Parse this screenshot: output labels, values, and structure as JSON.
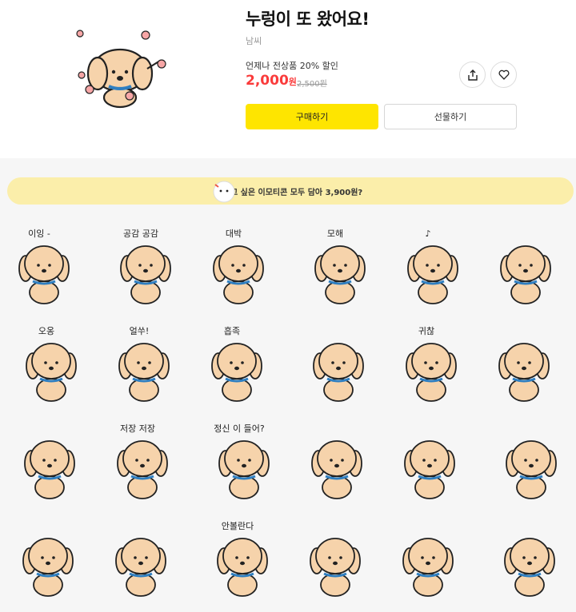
{
  "product": {
    "title": "누렁이 또 왔어요!",
    "author": "남씨",
    "promo_text": "언제나 전상품 20% 할인",
    "price": "2,000",
    "price_unit": "원",
    "original_price": "2,500원"
  },
  "actions": {
    "share_icon": "share-icon",
    "like_icon": "heart-icon",
    "buy_label": "구매하기",
    "gift_label": "선물하기"
  },
  "banner": {
    "text": "사고 싶은 이모티콘 모두 담아 3,900원?"
  },
  "colors": {
    "accent_yellow": "#fee500",
    "price_red": "#fa3b3b",
    "banner_bg": "#fbeeaa",
    "dog_fill": "#f6d3ab",
    "collar": "#2f7fc1"
  },
  "stickers": [
    {
      "caption": "이잉 -"
    },
    {
      "caption": "공감 공감"
    },
    {
      "caption": "대박"
    },
    {
      "caption": "모해"
    },
    {
      "caption": "♪"
    },
    {
      "caption": ""
    },
    {
      "caption": "오옹"
    },
    {
      "caption": "얼쑤!"
    },
    {
      "caption": "흡족"
    },
    {
      "caption": ""
    },
    {
      "caption": "귀찮"
    },
    {
      "caption": ""
    },
    {
      "caption": ""
    },
    {
      "caption": "저장 저장"
    },
    {
      "caption": "정신 이 들어?"
    },
    {
      "caption": ""
    },
    {
      "caption": ""
    },
    {
      "caption": ""
    },
    {
      "caption": ""
    },
    {
      "caption": ""
    },
    {
      "caption": "안볼란다"
    },
    {
      "caption": ""
    },
    {
      "caption": ""
    },
    {
      "caption": ""
    }
  ]
}
